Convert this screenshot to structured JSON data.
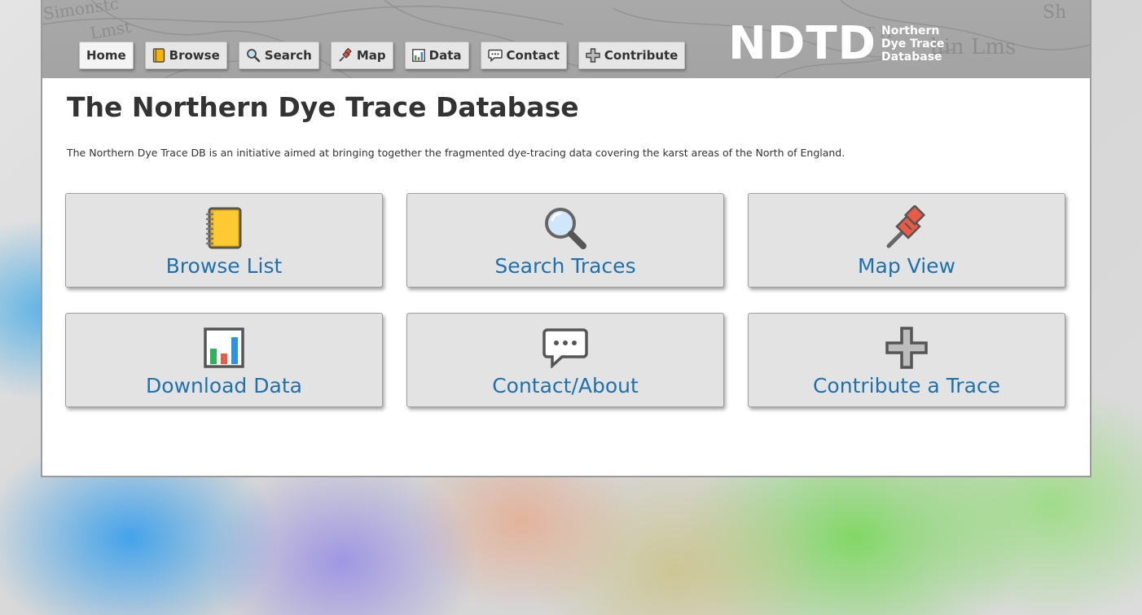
{
  "nav": {
    "items": [
      {
        "label": "Home",
        "icon": ""
      },
      {
        "label": "Browse",
        "icon": "notebook-icon"
      },
      {
        "label": "Search",
        "icon": "magnifier-icon"
      },
      {
        "label": "Map",
        "icon": "pushpin-icon"
      },
      {
        "label": "Data",
        "icon": "bar-chart-icon"
      },
      {
        "label": "Contact",
        "icon": "speech-bubble-icon"
      },
      {
        "label": "Contribute",
        "icon": "plus-icon"
      }
    ],
    "active": "Home"
  },
  "logo": {
    "abbr": "NDTD",
    "full": "Northern\nDye Trace\nDatabase"
  },
  "page": {
    "title": "The Northern Dye Trace Database",
    "intro": "The Northern Dye Trace DB is an initiative aimed at bringing together the fragmented dye-tracing data covering the karst areas of the North of England."
  },
  "tiles": [
    {
      "label": "Browse List",
      "icon": "notebook-icon"
    },
    {
      "label": "Search Traces",
      "icon": "magnifier-icon"
    },
    {
      "label": "Map View",
      "icon": "pushpin-icon"
    },
    {
      "label": "Download Data",
      "icon": "bar-chart-icon"
    },
    {
      "label": "Contact/About",
      "icon": "speech-bubble-icon"
    },
    {
      "label": "Contribute a Trace",
      "icon": "plus-icon"
    }
  ],
  "colors": {
    "link_blue": "#1d72ad",
    "header_grey": "#a9a9a9",
    "tile_bg": "#e3e3e3"
  }
}
